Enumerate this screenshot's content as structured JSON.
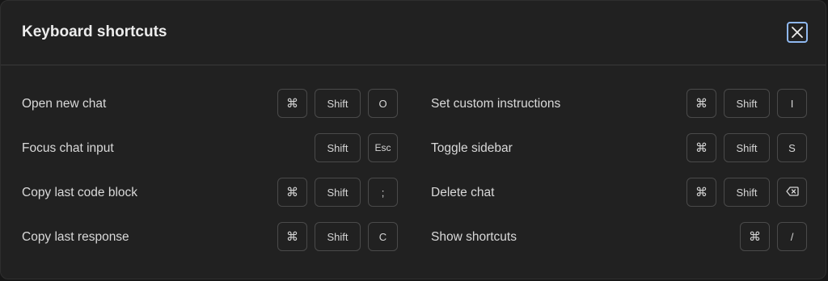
{
  "dialog": {
    "title": "Keyboard shortcuts",
    "close_icon": "close-icon"
  },
  "shortcuts_left": [
    {
      "label": "Open new chat",
      "keys": [
        "⌘",
        "Shift",
        "O"
      ]
    },
    {
      "label": "Focus chat input",
      "keys": [
        "Shift",
        "Esc"
      ]
    },
    {
      "label": "Copy last code block",
      "keys": [
        "⌘",
        "Shift",
        ";"
      ]
    },
    {
      "label": "Copy last response",
      "keys": [
        "⌘",
        "Shift",
        "C"
      ]
    }
  ],
  "shortcuts_right": [
    {
      "label": "Set custom instructions",
      "keys": [
        "⌘",
        "Shift",
        "I"
      ]
    },
    {
      "label": "Toggle sidebar",
      "keys": [
        "⌘",
        "Shift",
        "S"
      ]
    },
    {
      "label": "Delete chat",
      "keys": [
        "⌘",
        "Shift",
        "backspace-icon"
      ]
    },
    {
      "label": "Show shortcuts",
      "keys": [
        "⌘",
        "/"
      ]
    }
  ],
  "colors": {
    "background": "#212121",
    "text": "#ececec",
    "focus_ring": "#8fb8f0"
  }
}
